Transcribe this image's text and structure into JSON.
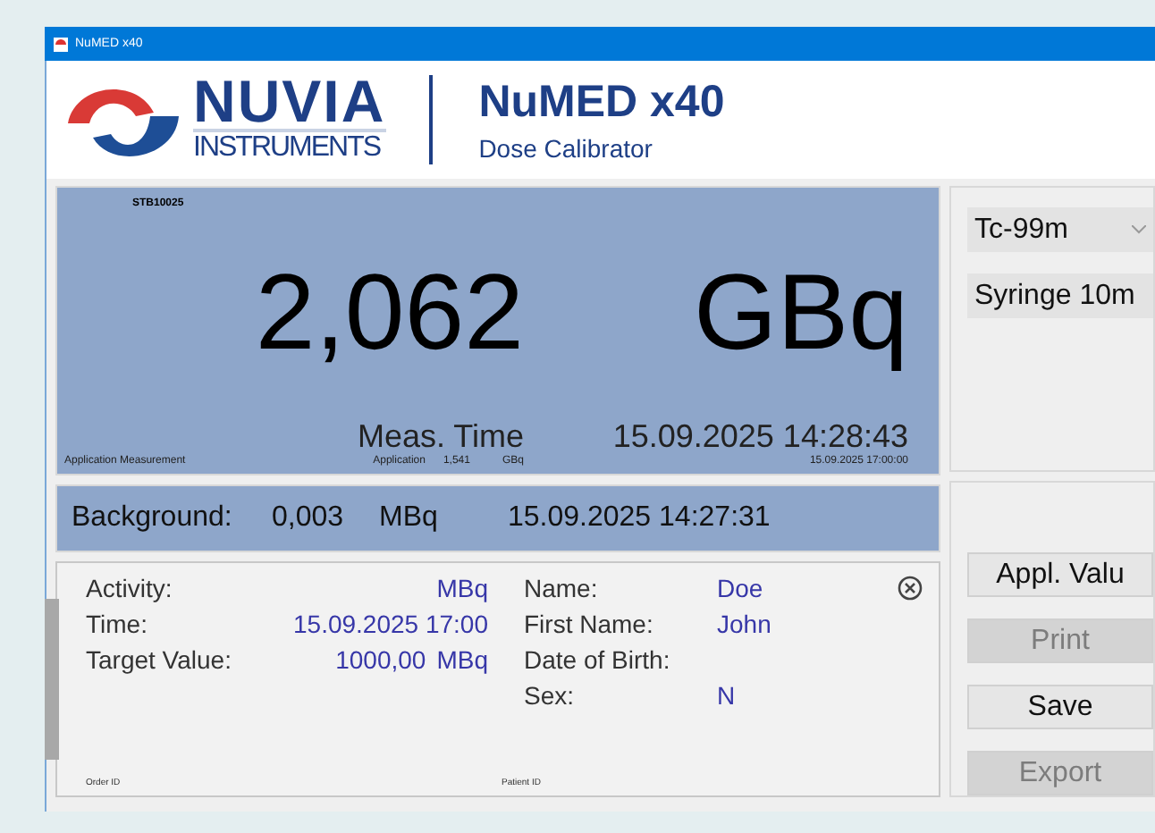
{
  "window": {
    "title": "NuMED x40"
  },
  "header": {
    "brand": "NUVIA",
    "brand_sub": "INSTRUMENTS",
    "product": "NuMED x40",
    "subtitle": "Dose Calibrator"
  },
  "measurement": {
    "serial": "STB10025",
    "value": "2,062",
    "unit": "GBq",
    "time_label": "Meas. Time",
    "time": "15.09.2025 14:28:43",
    "mode": "Application Measurement",
    "application_label": "Application",
    "application_value": "1,541",
    "application_unit": "GBq",
    "application_time": "15.09.2025 17:00:00"
  },
  "background": {
    "label": "Background:",
    "value": "0,003",
    "unit": "MBq",
    "time": "15.09.2025 14:27:31"
  },
  "order": {
    "fields": [
      {
        "label": "Activity:",
        "unit": "MBq"
      },
      {
        "label": "Time:",
        "value": "15.09.2025 17:00"
      },
      {
        "label": "Target Value:",
        "value": "1000,00",
        "unit": "MBq"
      }
    ],
    "id_label": "Order ID"
  },
  "patient": {
    "fields": [
      {
        "label": "Name:",
        "value": "Doe"
      },
      {
        "label": "First Name:",
        "value": "John"
      },
      {
        "label": "Date of Birth:"
      },
      {
        "label": "Sex:",
        "value": "N"
      }
    ],
    "id_label": "Patient ID"
  },
  "nuclide": {
    "value": "Tc-99m"
  },
  "geometry": {
    "value": "Syringe 10m"
  },
  "buttons": [
    {
      "label": "Appl. Valu",
      "disabled": false
    },
    {
      "label": "Print",
      "disabled": true
    },
    {
      "label": "Save",
      "disabled": false
    },
    {
      "label": "Export",
      "disabled": true
    }
  ]
}
